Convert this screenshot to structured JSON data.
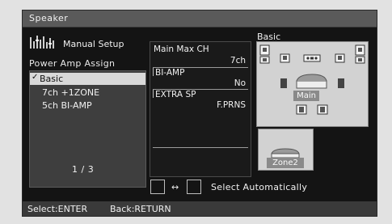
{
  "title": "Speaker",
  "left": {
    "setup_title": "Manual Setup",
    "section_label": "Power Amp Assign",
    "items": [
      {
        "label": "Basic",
        "selected": true
      },
      {
        "label": "7ch +1ZONE",
        "selected": false
      },
      {
        "label": "5ch BI-AMP",
        "selected": false
      }
    ],
    "check_mark": "✓",
    "page": "1 / 3"
  },
  "right": {
    "header": "Basic",
    "params": [
      {
        "name": "Main Max CH",
        "value": "7ch"
      },
      {
        "name": "BI-AMP",
        "value": "No"
      },
      {
        "name": "EXTRA SP",
        "value": "F.PRNS"
      }
    ],
    "main_zone_label": "Main",
    "zone2_label": "Zone2",
    "select_auto": "Select Automatically",
    "arrow": "↔"
  },
  "footer": {
    "select": "Select:ENTER",
    "back": "Back:RETURN"
  },
  "colors": {
    "screen_bg": "#141414",
    "title_bar": "#5a5a5a",
    "list_bg": "#3e3e3e",
    "selected_bg": "#d9d9d9",
    "diagram_bg": "#d2d2d2"
  }
}
